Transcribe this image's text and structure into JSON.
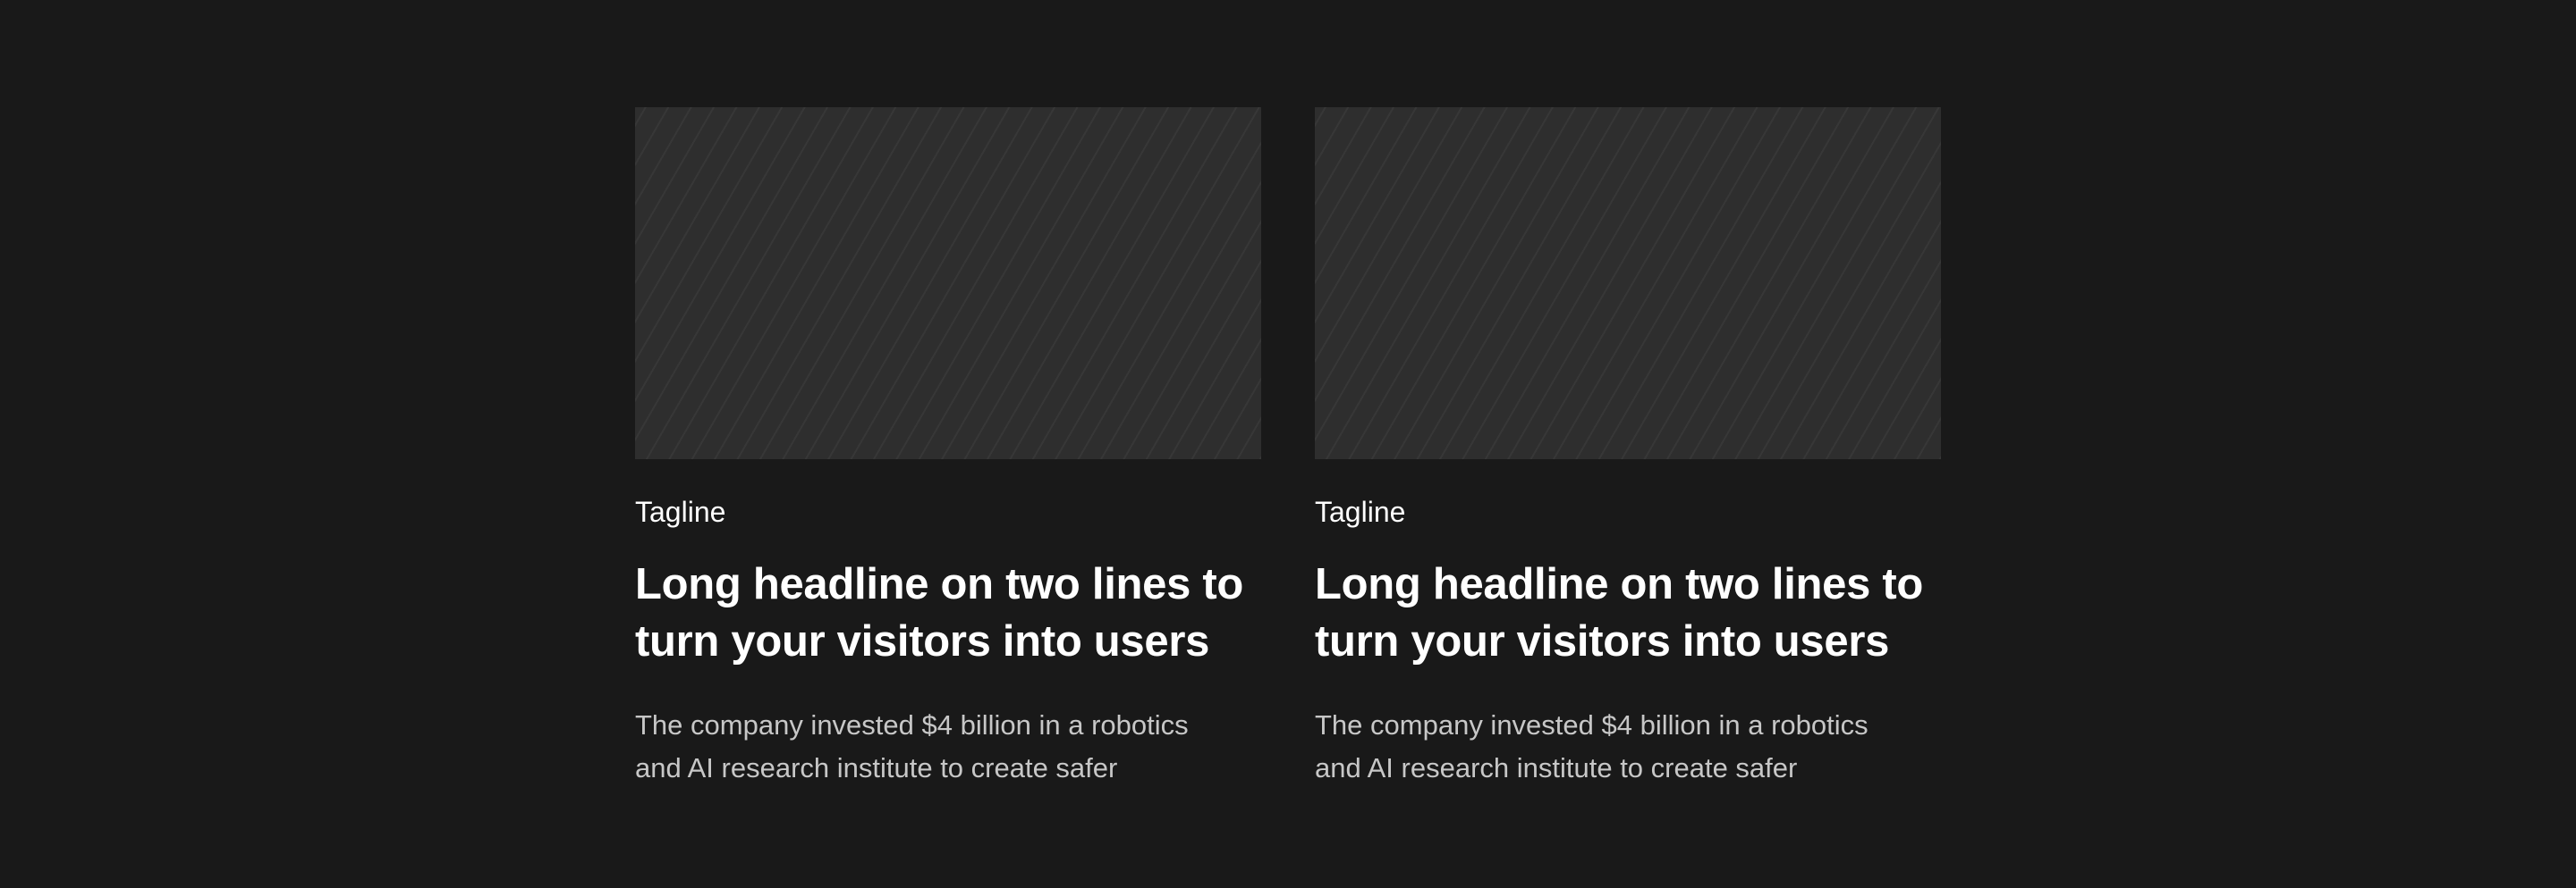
{
  "cards": [
    {
      "tagline": "Tagline",
      "headline_line1": "Long headline on two lines to",
      "headline_line2": "turn your visitors into users",
      "body_line1": "The company invested $4 billion in a robotics",
      "body_line2": "and AI research institute to create safer"
    },
    {
      "tagline": "Tagline",
      "headline_line1": "Long headline on two lines to",
      "headline_line2": "turn your visitors into users",
      "body_line1": "The company invested $4 billion in a robotics",
      "body_line2": "and AI research institute to create safer"
    }
  ],
  "colors": {
    "background": "#191919",
    "media_placeholder": "#2e2e2e",
    "headline": "#ffffff",
    "body": "#c7c7c7"
  }
}
